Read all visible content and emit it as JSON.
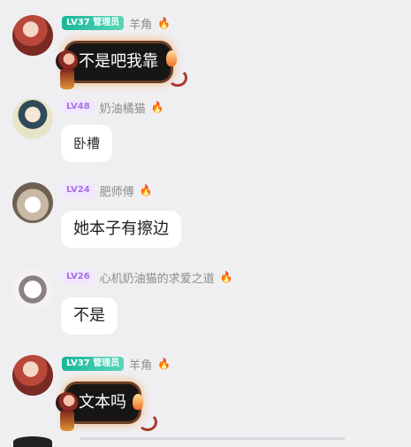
{
  "messages": [
    {
      "level": "LV37 管理员",
      "username": "羊角",
      "text": "不是吧我靠",
      "bubble_style": "dark",
      "avatar_icon": "avatar-red-costume",
      "badge_icon": "fire-icon"
    },
    {
      "level": "LV48",
      "username": "奶油橘猫",
      "text": "卧槽",
      "bubble_style": "light",
      "avatar_icon": "avatar-teal-hair",
      "badge_icon": "fire-icon"
    },
    {
      "level": "LV24",
      "username": "肥师傅",
      "text": "她本子有擦边",
      "bubble_style": "light",
      "avatar_icon": "avatar-cat",
      "badge_icon": "fire-icon"
    },
    {
      "level": "LV26",
      "username": "心机奶油猫的求爱之道",
      "text": "不是",
      "bubble_style": "light",
      "avatar_icon": "avatar-wolf",
      "badge_icon": "fire-icon"
    },
    {
      "level": "LV37 管理员",
      "username": "羊角",
      "text": "文本吗",
      "bubble_style": "dark",
      "avatar_icon": "avatar-red-costume",
      "badge_icon": "fire-icon"
    }
  ],
  "colors": {
    "background": "#efeff2",
    "admin_badge": "#19b69a",
    "level_badge": "#a770e6",
    "username": "#8b8b8b",
    "bubble_light": "#ffffff",
    "bubble_dark": "#181614",
    "glow": "#f79736"
  }
}
